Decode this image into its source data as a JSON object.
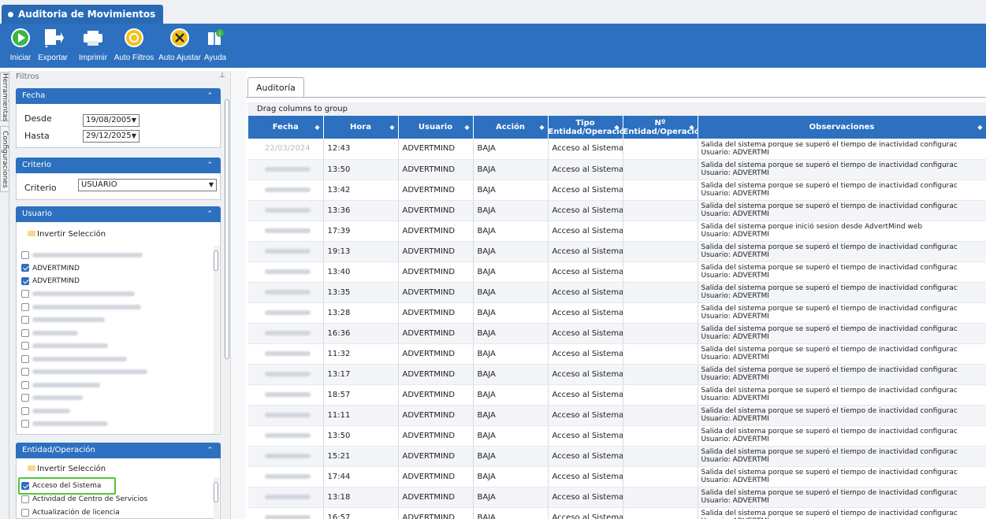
{
  "window": {
    "title": "Auditoria de Movimientos"
  },
  "toolbar": {
    "buttons": [
      {
        "label": "Iniciar",
        "icon": "play-icon"
      },
      {
        "label": "Exportar",
        "icon": "export-icon"
      },
      {
        "label": "Imprimir",
        "icon": "printer-icon"
      },
      {
        "label": "Auto Filtros",
        "icon": "auto-filter-icon"
      },
      {
        "label": "Auto Ajustar",
        "icon": "auto-adjust-icon"
      },
      {
        "label": "Ayuda",
        "icon": "help-book-icon"
      }
    ]
  },
  "side_tabs": [
    "Herramientas",
    "Configuraciones"
  ],
  "filters": {
    "header": "Filtros",
    "fecha": {
      "title": "Fecha",
      "desde_label": "Desde",
      "desde_value": "19/08/2005",
      "hasta_label": "Hasta",
      "hasta_value": "29/12/2025"
    },
    "criterio": {
      "title": "Criterio",
      "label": "Criterio",
      "value": "USUARIO"
    },
    "usuario": {
      "title": "Usuario",
      "invert_label": "Invertir Selección",
      "items": [
        {
          "label": "",
          "checked": false
        },
        {
          "label": "ADVERTMIND",
          "checked": true
        },
        {
          "label": "ADVERTMIND",
          "checked": true
        },
        {
          "label": "",
          "checked": false
        },
        {
          "label": "",
          "checked": false
        },
        {
          "label": "",
          "checked": false
        },
        {
          "label": "",
          "checked": false
        },
        {
          "label": "",
          "checked": false
        },
        {
          "label": "",
          "checked": false
        },
        {
          "label": "",
          "checked": false
        },
        {
          "label": "",
          "checked": false
        },
        {
          "label": "",
          "checked": false
        },
        {
          "label": "",
          "checked": false
        },
        {
          "label": "",
          "checked": false
        }
      ]
    },
    "entidad": {
      "title": "Entidad/Operación",
      "invert_label": "Invertir Selección",
      "items": [
        {
          "label": "Acceso del Sistema",
          "checked": true
        },
        {
          "label": "Actividad de Centro de Servicios",
          "checked": false
        },
        {
          "label": "Actualización de licencia",
          "checked": false
        }
      ]
    }
  },
  "main": {
    "tab": "Auditoría",
    "drag_hint": "Drag columns to group",
    "columns": [
      "Fecha",
      "Hora",
      "Usuario",
      "Acción",
      "Tipo Entidad/Operació",
      "Nº Entidad/Operació",
      "Observaciones"
    ],
    "rows": [
      {
        "fecha": "22/03/2024",
        "hora": "12:43",
        "usuario": "ADVERTMIND",
        "accion": "BAJA",
        "tipo": "Acceso al Sistema",
        "num": "",
        "obs1": "Salida del sistema porque se superó el tiempo de inactividad configurac",
        "obs2": "Usuario: ADVERTMI"
      },
      {
        "fecha": "",
        "hora": "13:50",
        "usuario": "ADVERTMIND",
        "accion": "BAJA",
        "tipo": "Acceso al Sistema",
        "num": "",
        "obs1": "Salida del sistema porque se superó el tiempo de inactividad configurac",
        "obs2": "Usuario: ADVERTMI"
      },
      {
        "fecha": "",
        "hora": "13:42",
        "usuario": "ADVERTMIND",
        "accion": "BAJA",
        "tipo": "Acceso al Sistema",
        "num": "",
        "obs1": "Salida del sistema porque se superó el tiempo de inactividad configurac",
        "obs2": "Usuario: ADVERTMI"
      },
      {
        "fecha": "",
        "hora": "13:36",
        "usuario": "ADVERTMIND",
        "accion": "BAJA",
        "tipo": "Acceso al Sistema",
        "num": "",
        "obs1": "Salida del sistema porque se superó el tiempo de inactividad configurac",
        "obs2": "Usuario: ADVERTMI"
      },
      {
        "fecha": "",
        "hora": "17:39",
        "usuario": "ADVERTMIND",
        "accion": "BAJA",
        "tipo": "Acceso al Sistema",
        "num": "",
        "obs1": "Salida del sistema porque inició sesion desde AdvertMind web",
        "obs2": "Usuario: ADVERTMI"
      },
      {
        "fecha": "",
        "hora": "19:13",
        "usuario": "ADVERTMIND",
        "accion": "BAJA",
        "tipo": "Acceso al Sistema",
        "num": "",
        "obs1": "Salida del sistema porque se superó el tiempo de inactividad configurac",
        "obs2": "Usuario: ADVERTMI"
      },
      {
        "fecha": "",
        "hora": "13:40",
        "usuario": "ADVERTMIND",
        "accion": "BAJA",
        "tipo": "Acceso al Sistema",
        "num": "",
        "obs1": "Salida del sistema porque se superó el tiempo de inactividad configurac",
        "obs2": "Usuario: ADVERTMI"
      },
      {
        "fecha": "",
        "hora": "13:35",
        "usuario": "ADVERTMIND",
        "accion": "BAJA",
        "tipo": "Acceso al Sistema",
        "num": "",
        "obs1": "Salida del sistema porque se superó el tiempo de inactividad configurac",
        "obs2": "Usuario: ADVERTMI"
      },
      {
        "fecha": "",
        "hora": "13:28",
        "usuario": "ADVERTMIND",
        "accion": "BAJA",
        "tipo": "Acceso al Sistema",
        "num": "",
        "obs1": "Salida del sistema porque se superó el tiempo de inactividad configurac",
        "obs2": "Usuario: ADVERTMI"
      },
      {
        "fecha": "",
        "hora": "16:36",
        "usuario": "ADVERTMIND",
        "accion": "BAJA",
        "tipo": "Acceso al Sistema",
        "num": "",
        "obs1": "Salida del sistema porque se superó el tiempo de inactividad configurac",
        "obs2": "Usuario: ADVERTMI"
      },
      {
        "fecha": "",
        "hora": "11:32",
        "usuario": "ADVERTMIND",
        "accion": "BAJA",
        "tipo": "Acceso al Sistema",
        "num": "",
        "obs1": "Salida del sistema porque se superó el tiempo de inactividad configurac",
        "obs2": "Usuario: ADVERTMI"
      },
      {
        "fecha": "",
        "hora": "13:17",
        "usuario": "ADVERTMIND",
        "accion": "BAJA",
        "tipo": "Acceso al Sistema",
        "num": "",
        "obs1": "Salida del sistema porque se superó el tiempo de inactividad configurac",
        "obs2": "Usuario: ADVERTMI"
      },
      {
        "fecha": "",
        "hora": "18:57",
        "usuario": "ADVERTMIND",
        "accion": "BAJA",
        "tipo": "Acceso al Sistema",
        "num": "",
        "obs1": "Salida del sistema porque se superó el tiempo de inactividad configurac",
        "obs2": "Usuario: ADVERTMI"
      },
      {
        "fecha": "",
        "hora": "11:11",
        "usuario": "ADVERTMIND",
        "accion": "BAJA",
        "tipo": "Acceso al Sistema",
        "num": "",
        "obs1": "Salida del sistema porque se superó el tiempo de inactividad configurac",
        "obs2": "Usuario: ADVERTMI"
      },
      {
        "fecha": "",
        "hora": "13:50",
        "usuario": "ADVERTMIND",
        "accion": "BAJA",
        "tipo": "Acceso al Sistema",
        "num": "",
        "obs1": "Salida del sistema porque se superó el tiempo de inactividad configurac",
        "obs2": "Usuario: ADVERTMI"
      },
      {
        "fecha": "",
        "hora": "15:21",
        "usuario": "ADVERTMIND",
        "accion": "BAJA",
        "tipo": "Acceso al Sistema",
        "num": "",
        "obs1": "Salida del sistema porque se superó el tiempo de inactividad configurac",
        "obs2": "Usuario: ADVERTMI"
      },
      {
        "fecha": "",
        "hora": "17:44",
        "usuario": "ADVERTMIND",
        "accion": "BAJA",
        "tipo": "Acceso al Sistema",
        "num": "",
        "obs1": "Salida del sistema porque se superó el tiempo de inactividad configurac",
        "obs2": "Usuario: ADVERTMI"
      },
      {
        "fecha": "",
        "hora": "13:18",
        "usuario": "ADVERTMIND",
        "accion": "BAJA",
        "tipo": "Acceso al Sistema",
        "num": "",
        "obs1": "Salida del sistema porque se superó el tiempo de inactividad configurac",
        "obs2": "Usuario: ADVERTMI"
      },
      {
        "fecha": "",
        "hora": "16:57",
        "usuario": "ADVERTMIND",
        "accion": "BAJA",
        "tipo": "Acceso al Sistema",
        "num": "",
        "obs1": "Salida del sistema porque se superó el tiempo de inactividad configurac",
        "obs2": "Usuario: ADVERTMI"
      }
    ]
  },
  "colors": {
    "brand_blue": "#2c70bf",
    "highlight_green": "#52c63b"
  }
}
